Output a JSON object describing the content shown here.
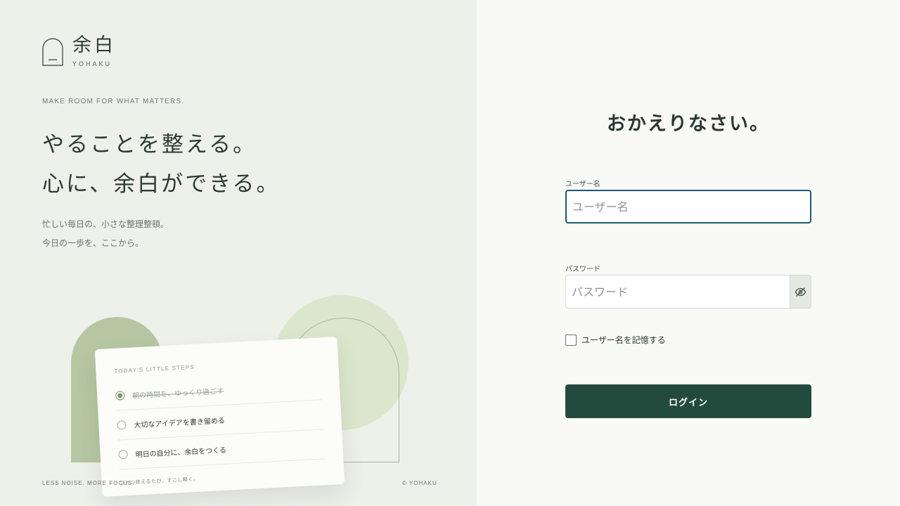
{
  "brand": {
    "name": "余白",
    "subtitle": "YOHAKU"
  },
  "hero": {
    "tagline": "MAKE ROOM FOR WHAT MATTERS.",
    "headline_line1": "やることを整える。",
    "headline_line2": "心に、余白ができる。",
    "desc_line1": "忙しい毎日の、小さな整理整頓。",
    "desc_line2": "今日の一歩を、ここから。"
  },
  "card": {
    "title": "TODAY'S LITTLE STEPS",
    "tasks": [
      {
        "label": "朝の時間を、ゆっくり過ごす",
        "done": true
      },
      {
        "label": "大切なアイデアを書き留める",
        "done": false
      },
      {
        "label": "明日の自分に、余白をつくる",
        "done": false
      }
    ],
    "footer": "ひとつ終えるたび、すこし軽く。"
  },
  "footer": {
    "left": "LESS NOISE. MORE FOCUS.",
    "right": "© YOHAKU"
  },
  "login": {
    "heading": "おかえりなさい。",
    "username_label": "ユーザー名",
    "username_placeholder": "ユーザー名",
    "username_value": "",
    "password_label": "パスワード",
    "password_placeholder": "パスワード",
    "password_value": "",
    "remember_label": "ユーザー名を記憶する",
    "remember_checked": false,
    "submit_label": "ログイン"
  },
  "colors": {
    "left_bg": "#eef0ea",
    "right_bg": "#f9f9f6",
    "accent": "#234b3d",
    "focus": "#1d5b74",
    "sage": "#b6c6a2",
    "sage_light": "#dbe6cd"
  },
  "icons": {
    "logo": "arch-logo-icon",
    "password_toggle": "eye-off-icon",
    "task_done": "radio-checked-icon",
    "task_open": "radio-empty-icon"
  }
}
